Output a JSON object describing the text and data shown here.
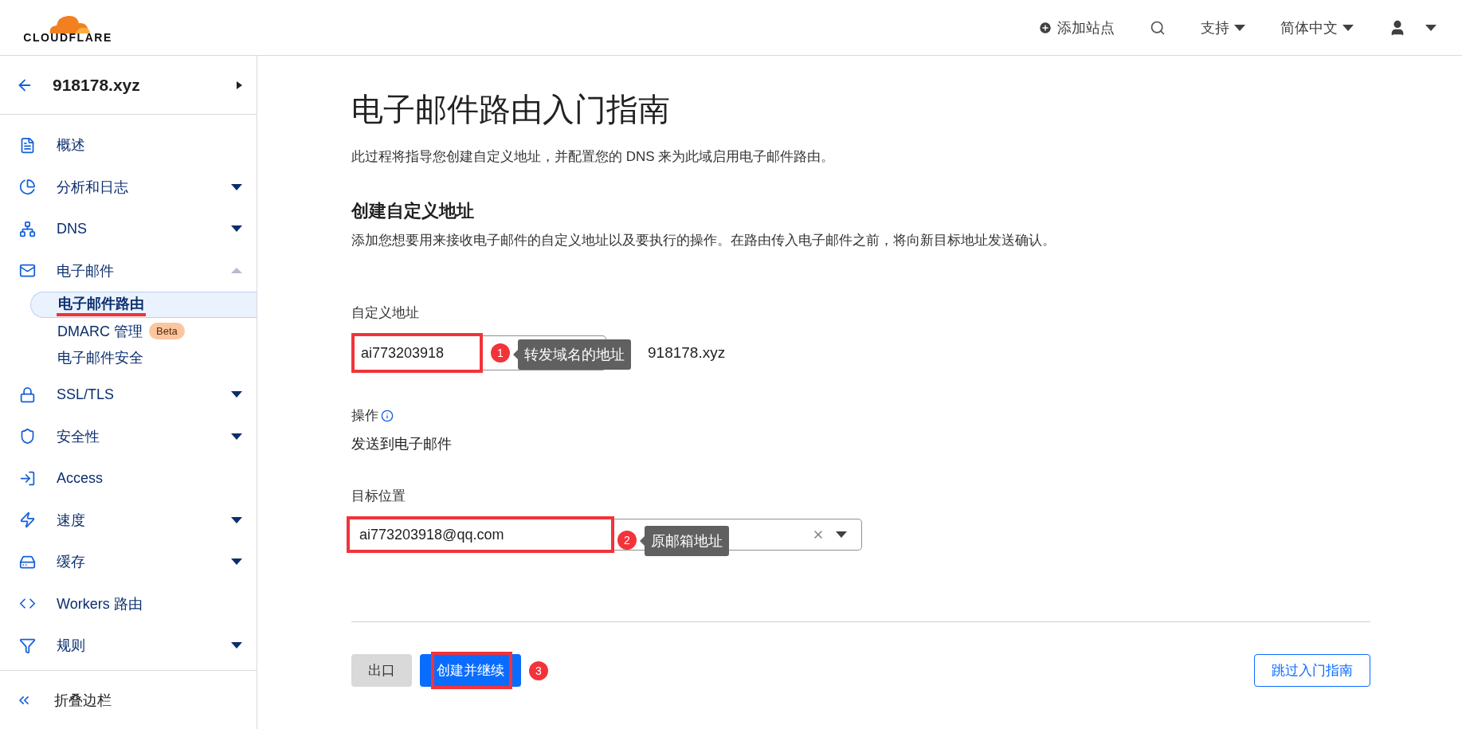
{
  "header": {
    "logo_text": "CLOUDFLARE",
    "nav": [
      {
        "kind": "add",
        "label": "添加站点"
      },
      {
        "kind": "search"
      },
      {
        "kind": "menu",
        "label": "支持"
      },
      {
        "kind": "menu",
        "label": "简体中文"
      },
      {
        "kind": "user"
      }
    ]
  },
  "sidebar": {
    "site": "918178.xyz",
    "items": [
      {
        "label": "概述"
      },
      {
        "label": "分析和日志",
        "expanded": false
      },
      {
        "label": "DNS",
        "expanded": false
      },
      {
        "label": "电子邮件",
        "expanded": true,
        "children": [
          {
            "label": "电子邮件路由",
            "selected": true
          },
          {
            "label": "DMARC 管理",
            "badge": "Beta",
            "selected": false
          },
          {
            "label": "电子邮件安全",
            "selected": false
          }
        ]
      },
      {
        "label": "SSL/TLS",
        "expanded": false
      },
      {
        "label": "安全性",
        "expanded": false
      },
      {
        "label": "Access"
      },
      {
        "label": "速度",
        "expanded": false
      },
      {
        "label": "缓存",
        "expanded": false
      },
      {
        "label": "Workers 路由"
      },
      {
        "label": "规则",
        "expanded": false
      }
    ],
    "collapse": "折叠边栏"
  },
  "main": {
    "title": "电子邮件路由入门指南",
    "subtitle": "此过程将指导您创建自定义地址，并配置您的 DNS 来为此域启用电子邮件路由。",
    "section_title": "创建自定义地址",
    "section_text": "添加您想要用来接收电子邮件的自定义地址以及要执行的操作。在路由传入电子邮件之前，将向新目标地址发送确认。",
    "custom_address": {
      "label": "自定义地址",
      "value": "ai773203918",
      "domain": "918178.xyz",
      "note": {
        "number": "1",
        "text": "转发域名的地址"
      }
    },
    "action": {
      "label": "操作",
      "value": "发送到电子邮件"
    },
    "destination": {
      "label": "目标位置",
      "value": "ai773203918@qq.com",
      "note": {
        "number": "2",
        "text": "原邮箱地址"
      }
    },
    "buttons": [
      {
        "kind": "secondary",
        "label": "出口"
      },
      {
        "kind": "primary",
        "label": "创建并继续",
        "note": {
          "number": "3"
        }
      },
      {
        "kind": "outline",
        "label": "跳过入门指南"
      }
    ]
  }
}
